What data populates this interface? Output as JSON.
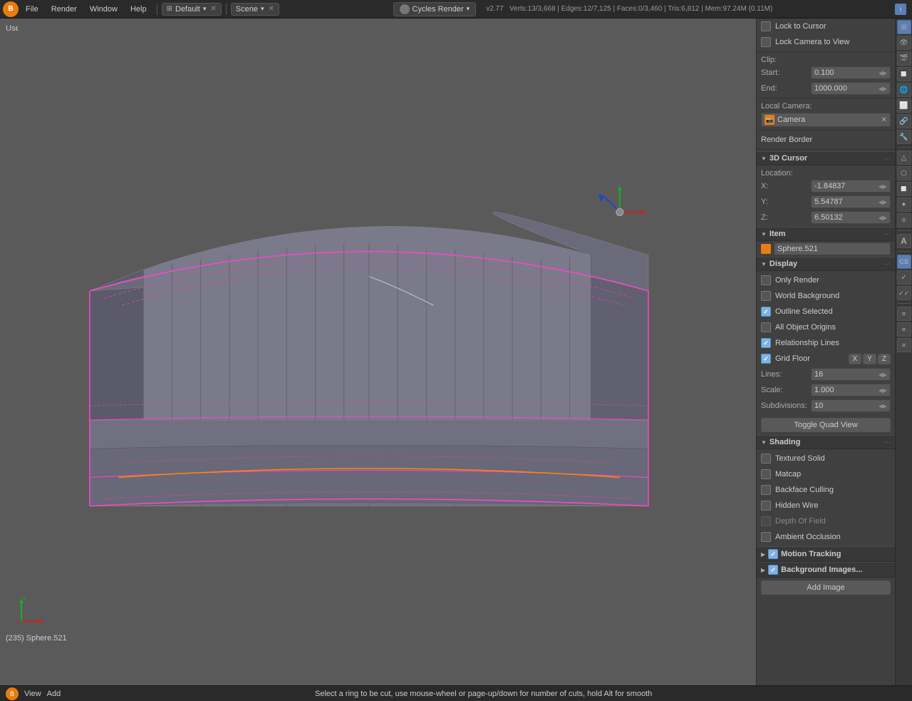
{
  "topbar": {
    "logo": "B",
    "menus": [
      "File",
      "Render",
      "Window",
      "Help"
    ],
    "screen_selector": "Default",
    "scene_selector": "Scene",
    "engine": "Cycles Render",
    "version": "v2.77",
    "stats": "Verts:13/3,668 | Edges:12/7,125 | Faces:0/3,460 | Tris:6,812 | Mem:97.24M (0.11M)"
  },
  "viewport": {
    "label": "User Ortho",
    "object_label": "(235) Sphere.521"
  },
  "right_panel": {
    "lock_to_cursor": "Lock to Cursor",
    "lock_camera_to_view": "Lock Camera to View",
    "clip_label": "Clip:",
    "clip_start_label": "Start:",
    "clip_start_value": "0.100",
    "clip_end_label": "End:",
    "clip_end_value": "1000.000",
    "local_camera_label": "Local Camera:",
    "camera_name": "Camera",
    "render_border": "Render Border",
    "cursor_section": "3D Cursor",
    "location_label": "Location:",
    "x_label": "X:",
    "x_value": "-1.84837",
    "y_label": "Y:",
    "y_value": "5.54787",
    "z_label": "Z:",
    "z_value": "6.50132",
    "item_section": "Item",
    "item_value": "Sphere.521",
    "display_section": "Display",
    "only_render": "Only Render",
    "world_background": "World Background",
    "outline_selected": "Outline Selected",
    "all_object_origins": "All Object Origins",
    "relationship_lines": "Relationship Lines",
    "grid_floor": "Grid Floor",
    "grid_x": "X",
    "grid_y": "Y",
    "grid_z": "Z",
    "lines_label": "Lines:",
    "lines_value": "16",
    "scale_label": "Scale:",
    "scale_value": "1.000",
    "subdivisions_label": "Subdivisions:",
    "subdivisions_value": "10",
    "toggle_quad_view": "Toggle Quad View",
    "shading_section": "Shading",
    "textured_solid": "Textured Solid",
    "matcap": "Matcap",
    "backface_culling": "Backface Culling",
    "hidden_wire": "Hidden Wire",
    "depth_of_field": "Depth Of Field",
    "ambient_occlusion": "Ambient Occlusion",
    "motion_tracking_section": "Motion Tracking",
    "background_images_section": "Background Images...",
    "add_image": "Add Image"
  },
  "statusbar": {
    "left_icon": "☰",
    "view_label": "View",
    "add_label": "Add",
    "status_text": "Select a ring to be cut, use mouse-wheel or page-up/down for number of cuts, hold Alt for smooth"
  },
  "checkboxes": {
    "lock_to_cursor": false,
    "lock_camera_to_view": false,
    "only_render": false,
    "world_background": false,
    "outline_selected": true,
    "all_object_origins": false,
    "relationship_lines": true,
    "grid_floor": true,
    "grid_x": true,
    "grid_y": false,
    "grid_z": false,
    "textured_solid": false,
    "matcap": false,
    "backface_culling": false,
    "hidden_wire": false,
    "depth_of_field": false,
    "ambient_occlusion": false,
    "motion_tracking": true,
    "background_images": true
  }
}
